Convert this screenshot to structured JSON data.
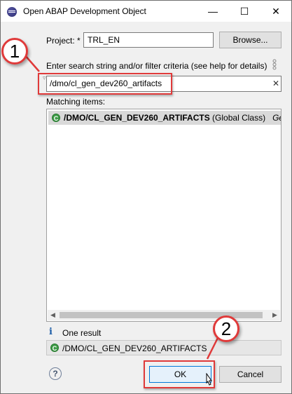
{
  "window": {
    "title": "Open ABAP Development Object"
  },
  "titlebar_buttons": {
    "minimize": "—",
    "maximize": "☐",
    "close": "✕"
  },
  "project": {
    "label": "Project: *",
    "value": "TRL_EN",
    "browse_label": "Browse..."
  },
  "search": {
    "label": "Enter search string and/or filter criteria (see help for details)",
    "value": "/dmo/cl_gen_dev260_artifacts",
    "clear": "✕"
  },
  "matching": {
    "label": "Matching items:",
    "items": [
      {
        "name": "/DMO/CL_GEN_DEV260_ARTIFACTS",
        "type": " (Global Class)",
        "desc": "Gener"
      }
    ]
  },
  "result": {
    "info_icon": "i",
    "text": "One result",
    "selected": "/DMO/CL_GEN_DEV260_ARTIFACTS"
  },
  "buttons": {
    "help": "?",
    "ok": "OK",
    "cancel": "Cancel"
  },
  "callouts": {
    "one": "1",
    "two": "2"
  },
  "colors": {
    "accent_red": "#e03a3a",
    "selection": "#d9d9d9",
    "class_icon": "#3c9a45"
  }
}
